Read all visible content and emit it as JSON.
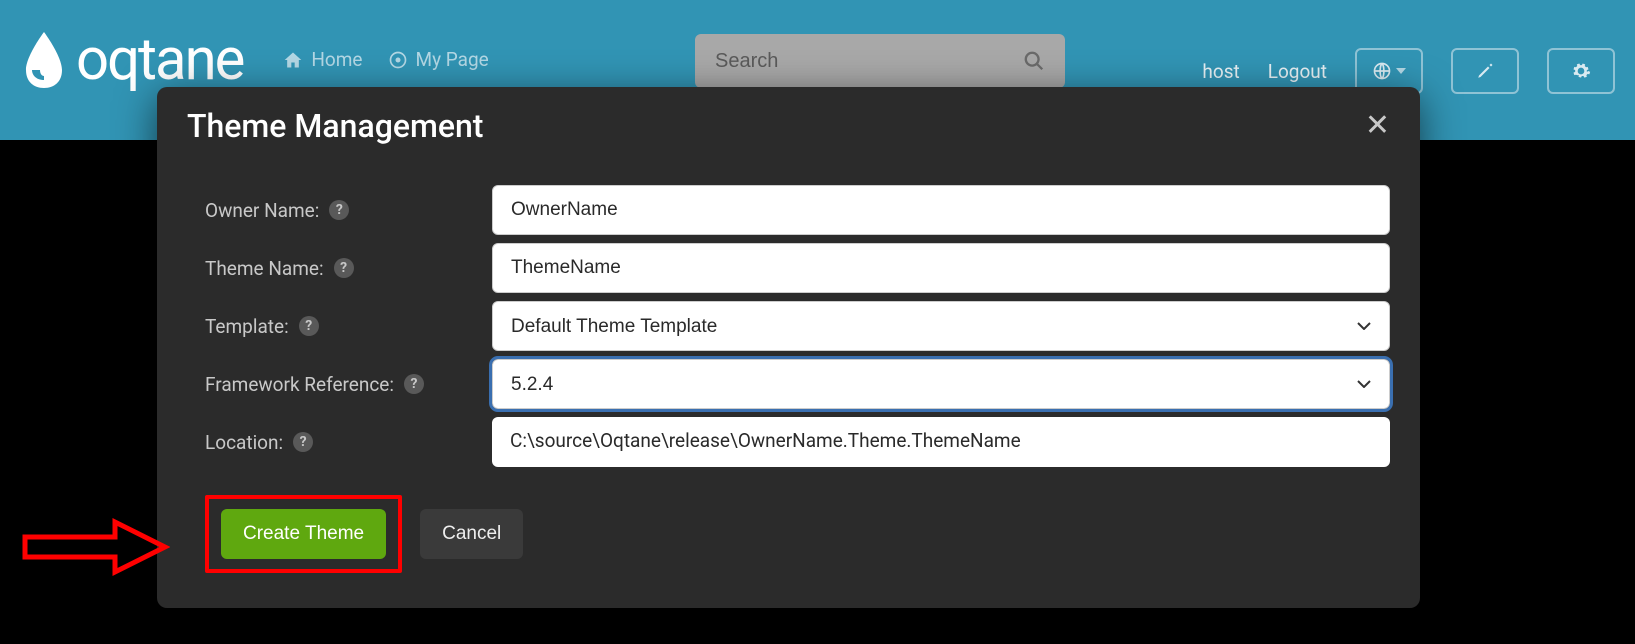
{
  "header": {
    "logo_text": "oqtane",
    "nav": {
      "home": "Home",
      "mypage": "My Page"
    },
    "search_placeholder": "Search",
    "user": "host",
    "logout": "Logout"
  },
  "modal": {
    "title": "Theme Management",
    "labels": {
      "owner": "Owner Name:",
      "theme": "Theme Name:",
      "template": "Template:",
      "framework": "Framework Reference:",
      "location": "Location:"
    },
    "values": {
      "owner": "OwnerName",
      "theme": "ThemeName",
      "template": "Default Theme Template",
      "framework": "5.2.4",
      "location": "C:\\source\\Oqtane\\release\\OwnerName.Theme.ThemeName"
    },
    "actions": {
      "create": "Create Theme",
      "cancel": "Cancel"
    }
  }
}
